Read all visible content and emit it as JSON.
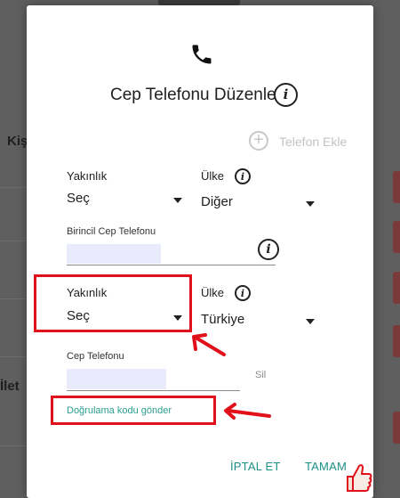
{
  "background": {
    "labels": [
      "Kiş",
      "İlet"
    ]
  },
  "dialog": {
    "icon": "phone-icon",
    "title": "Cep Telefonu Düzenle",
    "add_phone_label": "Telefon Ekle",
    "primary": {
      "relation_label": "Yakınlık",
      "relation_value": "Seç",
      "country_label": "Ülke",
      "country_value": "Diğer",
      "phone_label": "Birincil Cep Telefonu"
    },
    "secondary": {
      "relation_label": "Yakınlık",
      "relation_value": "Seç",
      "country_label": "Ülke",
      "country_value": "Türkiye",
      "phone_label": "Cep Telefonu",
      "delete_label": "Sil",
      "verify_link": "Doğrulama kodu gönder"
    },
    "buttons": {
      "cancel": "İPTAL ET",
      "ok": "TAMAM"
    }
  },
  "colors": {
    "accent": "#1e8f87",
    "annotation_red": "#e0111a",
    "input_highlight": "#e9ebfd"
  }
}
